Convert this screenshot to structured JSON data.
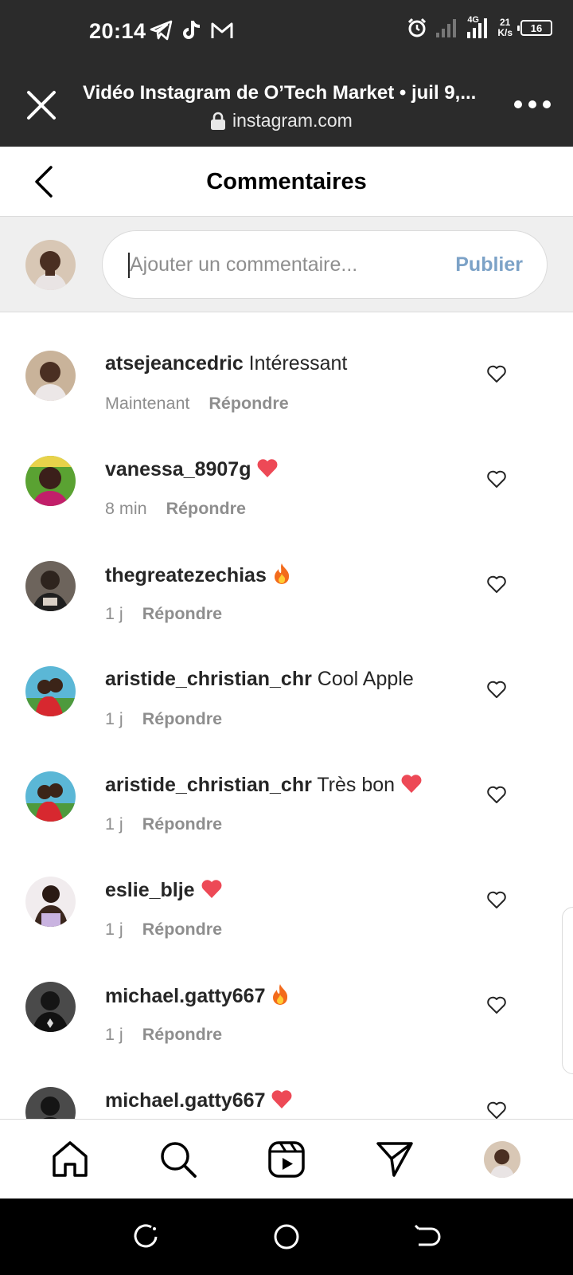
{
  "status_bar": {
    "time": "20:14",
    "net_speed_value": "21",
    "net_speed_unit": "K/s",
    "network_type": "4G",
    "battery": "16",
    "left_icons": [
      "telegram-icon",
      "tiktok-icon",
      "gmail-icon"
    ],
    "right_icons": [
      "alarm-icon",
      "signal-icon",
      "signal-4g-icon",
      "battery-icon"
    ]
  },
  "browser": {
    "title": "Vidéo Instagram de O’Tech Market • juil 9,...",
    "domain": "instagram.com"
  },
  "header": {
    "title": "Commentaires"
  },
  "composer": {
    "placeholder": "Ajouter un commentaire...",
    "publish_label": "Publier"
  },
  "comments": [
    {
      "username": "atsejeancedric",
      "text": "Intéressant",
      "emoji": "",
      "time": "Maintenant",
      "reply_label": "Répondre",
      "avatar_color": "#c9b39a"
    },
    {
      "username": "vanessa_8907g",
      "text": "",
      "emoji": "heart",
      "time": "8 min",
      "reply_label": "Répondre",
      "avatar_color": "#5aa232"
    },
    {
      "username": "thegreatezechias",
      "text": "",
      "emoji": "fire",
      "time": "1 j",
      "reply_label": "Répondre",
      "avatar_color": "#6d645c"
    },
    {
      "username": "aristide_christian_chr",
      "text": "Cool Apple",
      "emoji": "",
      "time": "1 j",
      "reply_label": "Répondre",
      "avatar_color": "#5bb7d6"
    },
    {
      "username": "aristide_christian_chr",
      "text": "Très bon",
      "emoji": "heart",
      "time": "1 j",
      "reply_label": "Répondre",
      "avatar_color": "#5bb7d6"
    },
    {
      "username": "eslie_blje",
      "text": "",
      "emoji": "heart",
      "time": "1 j",
      "reply_label": "Répondre",
      "avatar_color": "#e9e2e4"
    },
    {
      "username": "michael.gatty667",
      "text": "",
      "emoji": "fire",
      "time": "1 j",
      "reply_label": "Répondre",
      "avatar_color": "#3a3a3a"
    },
    {
      "username": "michael.gatty667",
      "text": "",
      "emoji": "heart",
      "time": "",
      "reply_label": "",
      "avatar_color": "#3a3a3a"
    }
  ],
  "bottom_nav": [
    "home-icon",
    "search-icon",
    "reels-icon",
    "direct-icon",
    "profile-avatar"
  ],
  "colors": {
    "accent_publish": "#7ca2c7",
    "heart_red": "#ed4956",
    "meta_gray": "#8e8e8e",
    "browser_bar": "#2b2b2b"
  }
}
